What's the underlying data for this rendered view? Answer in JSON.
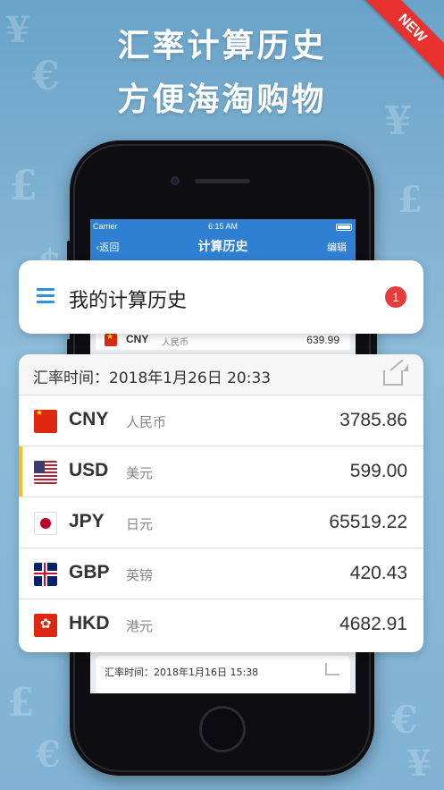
{
  "promo": {
    "line1": "汇率计算历史",
    "line2": "方便海淘购物",
    "ribbon": "NEW"
  },
  "phone_screen": {
    "status_carrier": "Carrier",
    "status_time": "6:15 AM",
    "back_label": "返回",
    "nav_title": "计算历史",
    "edit_label": "编辑",
    "peek_row": {
      "code": "CNY",
      "name": "人民币",
      "value": "639.99"
    },
    "peek_card_time": "汇率时间：2018年1月16日 15:38"
  },
  "history_header": {
    "title": "我的计算历史",
    "badge_count": "1"
  },
  "history_card": {
    "time_label": "汇率时间：2018年1月26日 20:33",
    "rows": [
      {
        "code": "CNY",
        "name": "人民币",
        "value": "3785.86",
        "flag": "cn-flag-icon"
      },
      {
        "code": "USD",
        "name": "美元",
        "value": "599.00",
        "flag": "us-flag-icon",
        "active": true
      },
      {
        "code": "JPY",
        "name": "日元",
        "value": "65519.22",
        "flag": "jp-flag-icon"
      },
      {
        "code": "GBP",
        "name": "英镑",
        "value": "420.43",
        "flag": "gb-flag-icon"
      },
      {
        "code": "HKD",
        "name": "港元",
        "value": "4682.91",
        "flag": "hk-flag-icon"
      }
    ]
  },
  "colors": {
    "accent": "#2f7fd3",
    "badge": "#ea3b3b",
    "active_marker": "#f2c21b"
  }
}
